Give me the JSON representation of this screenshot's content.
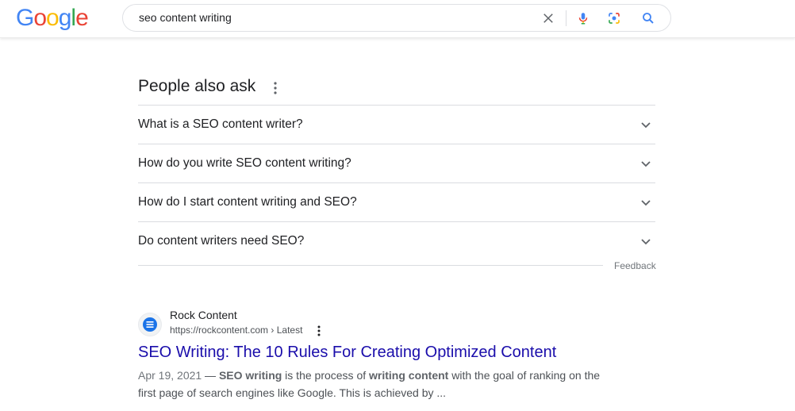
{
  "logo": {
    "letters": [
      "G",
      "o",
      "o",
      "g",
      "l",
      "e"
    ],
    "colors": [
      "#4285F4",
      "#EA4335",
      "#FBBC05",
      "#4285F4",
      "#34A853",
      "#EA4335"
    ]
  },
  "search": {
    "query": "seo content writing"
  },
  "icons": {
    "clear": "close-icon",
    "voice": "mic-icon",
    "lens": "lens-icon",
    "search": "search-icon"
  },
  "paa": {
    "title": "People also ask",
    "questions": [
      "What is a SEO content writer?",
      "How do you write SEO content writing?",
      "How do I start content writing and SEO?",
      "Do content writers need SEO?"
    ],
    "feedback": "Feedback"
  },
  "result": {
    "site_name": "Rock Content",
    "url": "https://rockcontent.com › Latest",
    "title": "SEO Writing: The 10 Rules For Creating Optimized Content",
    "date": "Apr 19, 2021",
    "snippet_parts": [
      " — ",
      "SEO writing",
      " is the process of ",
      "writing content",
      " with the goal of ranking on the first page of search engines like Google. This is achieved by ..."
    ]
  },
  "colors": {
    "link": "#1a0dab",
    "accent_blue": "#4285F4",
    "mic_red": "#EA4335"
  }
}
